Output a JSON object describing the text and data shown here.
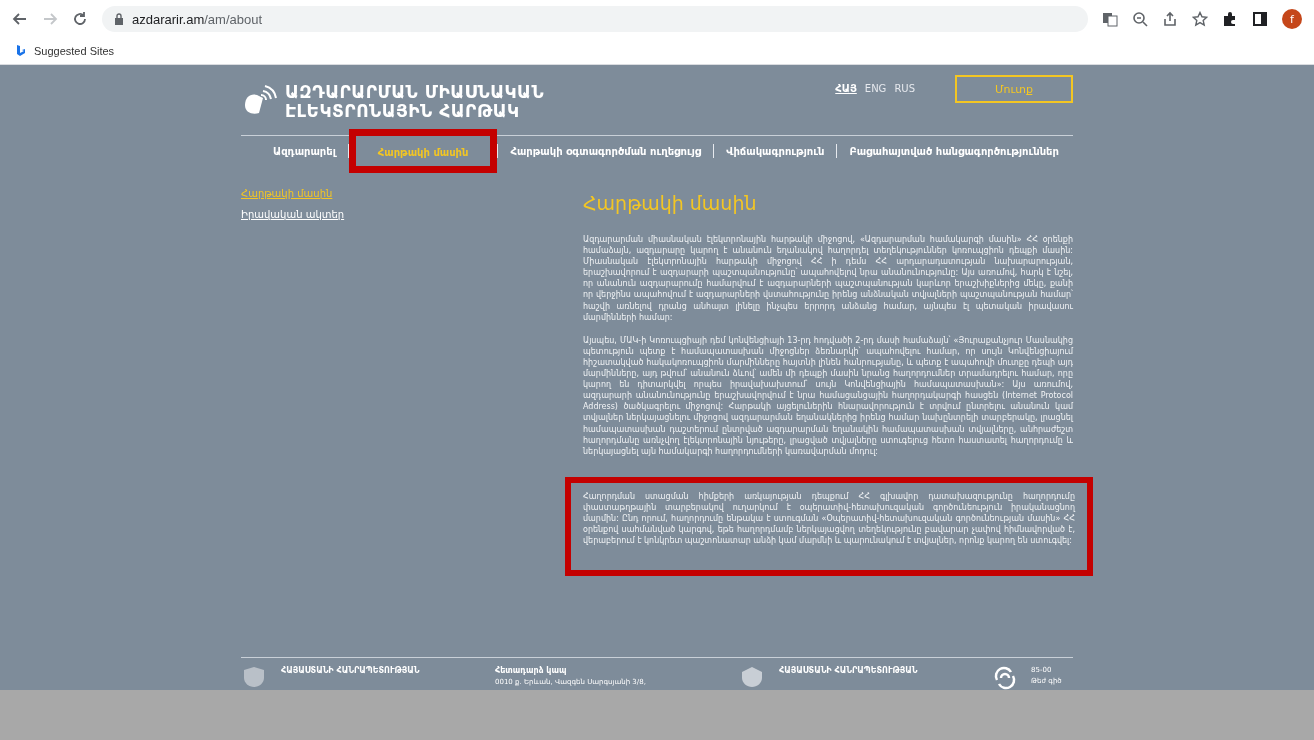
{
  "browser": {
    "url_host": "azdararir.am",
    "url_path": "/am/about",
    "profile_initial": "f",
    "bookmarks": [
      {
        "label": "Suggested Sites"
      }
    ]
  },
  "site": {
    "title_lines": [
      "ԱԶԴԱՐԱՐՄԱՆ ՄԻԱՍՆԱԿԱՆ",
      "ԷԼԵԿՏՐՈՆԱՅԻՆ ՀԱՐԹԱԿ"
    ],
    "languages": [
      {
        "label": "ՀԱՅ",
        "selected": true
      },
      {
        "label": "ENG",
        "selected": false
      },
      {
        "label": "RUS",
        "selected": false
      }
    ],
    "login_button": "Մուտք",
    "nav": [
      {
        "label": "Ազդարարել",
        "selected": false,
        "highlighted": false
      },
      {
        "label": "Հարթակի մասին",
        "selected": true,
        "highlighted": true
      },
      {
        "label": "Հարթակի օգտագործման ուղեցույց",
        "selected": false,
        "highlighted": false
      },
      {
        "label": "Վիճակագրություն",
        "selected": false,
        "highlighted": false
      },
      {
        "label": "Բացահայտված հանցագործություններ",
        "selected": false,
        "highlighted": false
      }
    ],
    "sidebar": [
      {
        "label": "Հարթակի մասին",
        "selected": true
      },
      {
        "label": "Իրավական ակտեր",
        "selected": false
      }
    ],
    "heading": "Հարթակի մասին",
    "paragraphs": [
      {
        "text": "Ազդարարման միասնական էլեկտրոնային հարթակի միջոցով, «Ազդարարման համակարգի մասին» ՀՀ օրենքի համաձայն, ազդարարը կարող է անանուն եղանակով հաղորդել տեղեկություններ կոռուպցիոն դեպքի մասին: Միասնական էլեկտրոնային հարթակի միջոցով ՀՀ ի դեմս ՀՀ արդարադատության նախարարության, երաշխավորում է ազդարարի պաշտպանությունը՝ ապահովելով նրա անանունությունը: Այս առումով, հարկ է նշել, որ անանուն ազդարարումը համարվում է ազդարարների պաշտպանության կարևոր երաշխիքներից մեկը, քանի որ վերջինս ապահովում է ազդարարների վստահությունը իրենց անձնական տվյալների պաշտպանության համար՝ հաշվի առնելով դրանց անհայտ լինելը ինչպես երրորդ անձանց համար, այնպես էլ պետական իրավասու մարմինների համար:",
        "highlighted": false
      },
      {
        "text": "Այսպես, ՄԱԿ-ի Կոռուպցիայի դեմ կոնվենցիայի 13-րդ հոդվածի 2-րդ մասի համաձայն՝ «Յուրաքանչյուր Մասնակից պետություն պետք է համապատասխան միջոցներ ձեռնարկի՝ ապահովելու համար, որ սույն Կոնվենցիայում հիշատակված հակակոռուպցիոն մարմինները հայտնի լինեն հանրությանը, և պետք է ապահովի մուտքը դեպի այդ մարմինները, այդ թվում՝ անանուն ձևով՝ ամեն մի դեպքի մասին նրանց հաղորդումներ տրամադրելու համար, որը կարող են դիտարկվել որպես իրավախախտում՝ սույն Կոնվենցիային համապատասխան»: Այս առումով, ազդարարի անանունությունը երաշխավորվում է նրա համացանցային հաղորդակարգի հասցեն (Internet Protocol Address) ծածկագրելու միջոցով: Հարթակի այցելուներին հնարավորություն է տրվում ընտրելու անանուն կամ տվյալներ ներկայացնելու միջոցով ազդարարման եղանակներից իրենց համար նախընտրելի տարբերակը, լրացնել համապատասխան դաշտերում ընտրված ազդարարման եղանակին համապատասխան տվյալները, անհրաժեշտ հաղորդմանը առնչվող էլեկտրոնային նյութերը, լրացված տվյալները ստուգելուց հետո հաստատել հաղորդումը և ներկայացնել այն համակարգի հաղորդումների կառավարման մոդուլ:",
        "highlighted": false
      },
      {
        "text": "Հաղորդման ստացման հիմքերի առկայության դեպքում ՀՀ գլխավոր դատախազությունը հաղորդումը փաստաթղթային տարբերակով ուղարկում է օպերատիվ-հետախուզական գործունեություն իրականացնող մարմին: Ընդ որում, հաղորդումը ենթակա է ստուգման «Օպերատիվ-հետախուզական գործունեության մասին» ՀՀ օրենքով սահմանված կարգով, եթե հաղորդմամբ ներկայացվող տեղեկությունը բավարար չափով հիմնավորված է, վերաբերում է կոնկրետ պաշտոնատար անձի կամ մարմնի և պարունակում է տվյալներ, որոնք կարող են ստուգվել:",
        "highlighted": true
      }
    ],
    "footer": {
      "org_left": "ՀԱՅԱՍՏԱՆԻ ՀԱՆՐԱՊԵՏՈՒԹՅԱՆ",
      "contact_title": "Հետադարձ կապ",
      "contact_address": "0010 ք. Երևան, Վազգեն Սարգսյանի 3/8,",
      "org_right": "ՀԱՅԱՍՏԱՆԻ ՀԱՆՐԱՊԵՏՈՒԹՅԱՆ",
      "hotline_number": "85-00",
      "hotline_label": "Թեժ գիծ"
    }
  }
}
